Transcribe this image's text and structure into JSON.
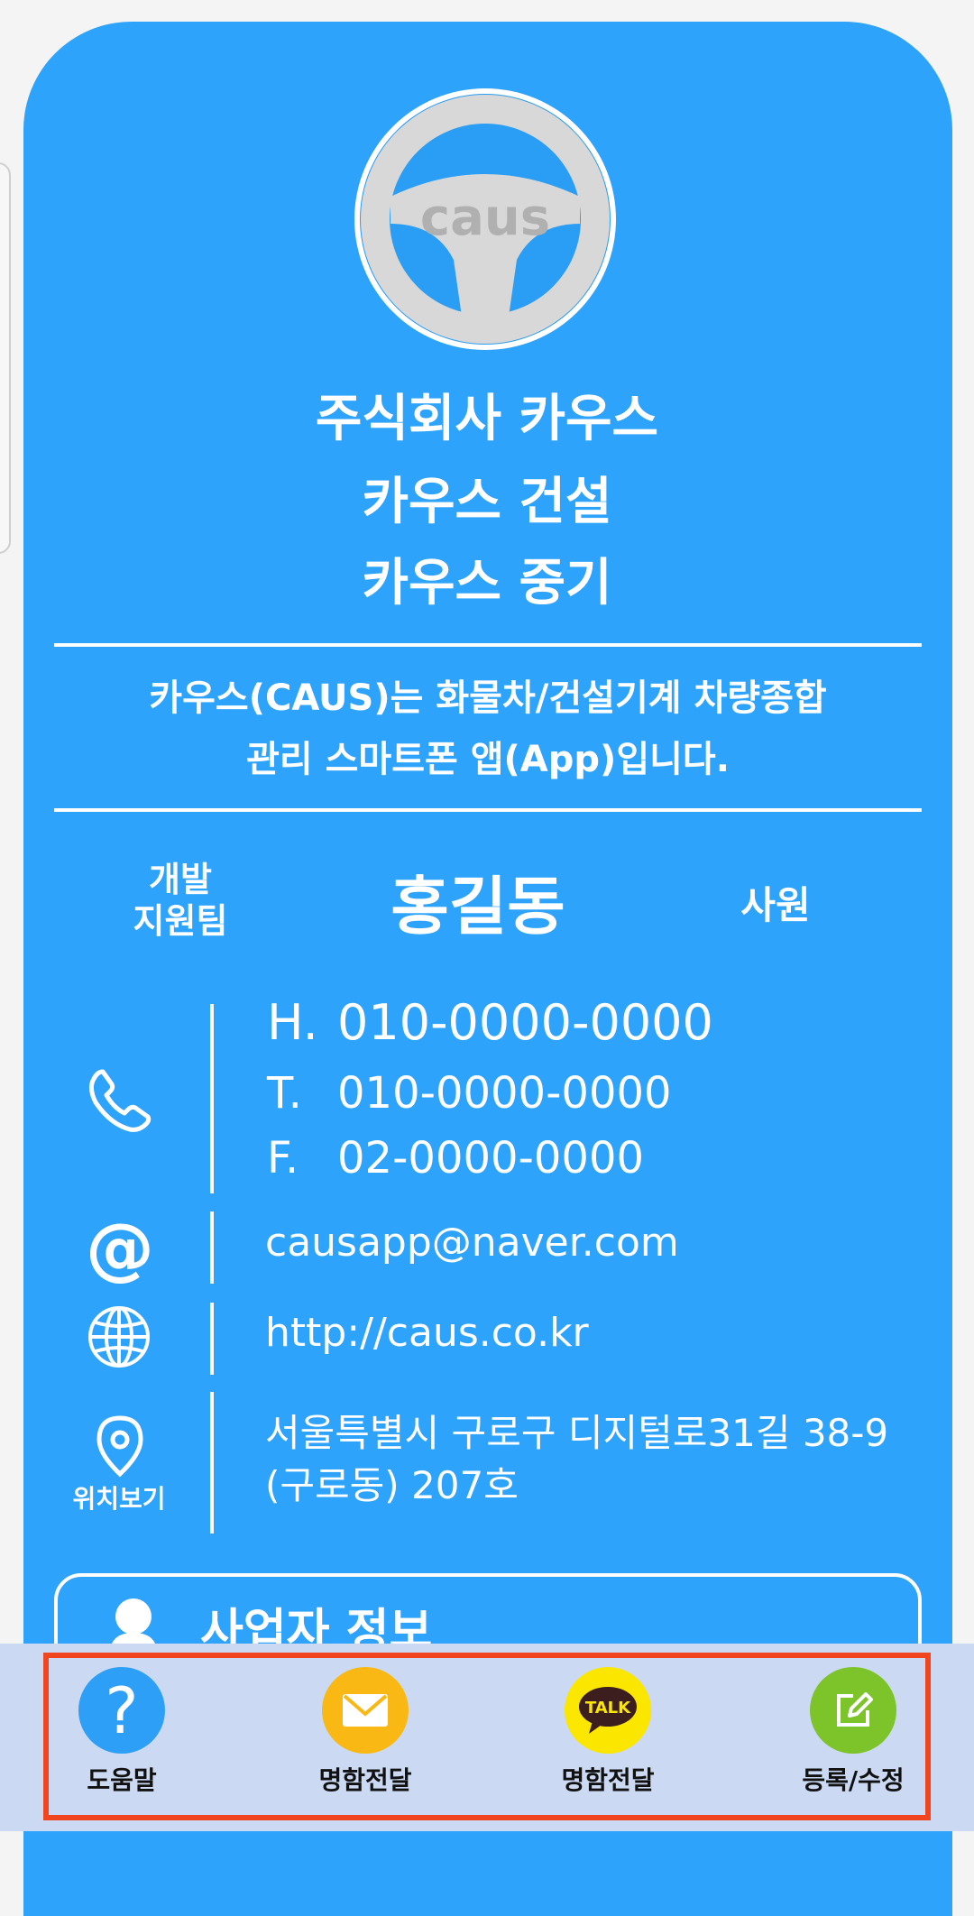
{
  "logo": {
    "text": "caus"
  },
  "company_lines": [
    "주식회사 카우스",
    "카우스 건설",
    "카우스 중기"
  ],
  "description": [
    "카우스(CAUS)는 화물차/건설기계 차량종합",
    "관리 스마트폰 앱(App)입니다."
  ],
  "person": {
    "department": [
      "개발",
      "지원팀"
    ],
    "name": "홍길동",
    "rank": "사원"
  },
  "contact": {
    "phones": [
      {
        "label": "H.",
        "number": "010-0000-0000"
      },
      {
        "label": "T.",
        "number": "010-0000-0000"
      },
      {
        "label": "F.",
        "number": "02-0000-0000"
      }
    ],
    "email": "causapp@naver.com",
    "website": "http://caus.co.kr",
    "location_label": "위치보기",
    "address": [
      "서울특별시 구로구 디지털로31길 38-9",
      "(구로동) 207호"
    ]
  },
  "business_info_title": "사업자 정보",
  "bottom_nav": [
    {
      "label": "도움말",
      "icon": "help-icon",
      "color": "#2e9ff7"
    },
    {
      "label": "명함전달",
      "icon": "mail-icon",
      "color": "#f9b814"
    },
    {
      "label": "명함전달",
      "icon": "kakao-talk-icon",
      "icon_text": "TALK",
      "color": "#fbe600"
    },
    {
      "label": "등록/수정",
      "icon": "edit-icon",
      "color": "#7cc42a"
    }
  ]
}
